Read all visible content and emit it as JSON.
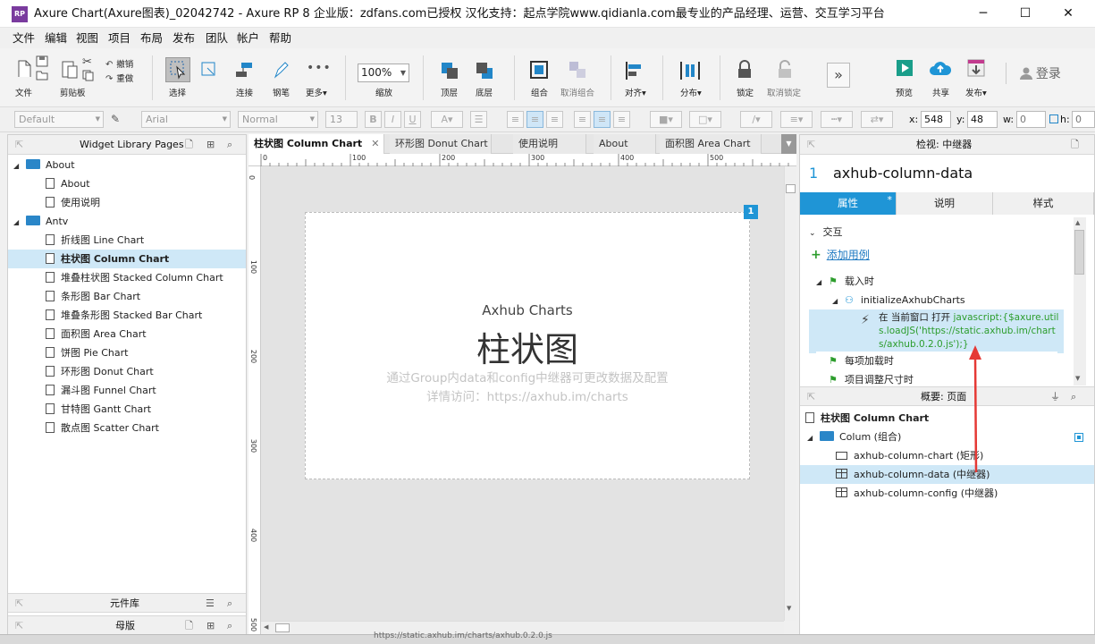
{
  "window": {
    "title": "Axure Chart(Axure图表)_02042742 - Axure RP 8 企业版：zdfans.com已授权 汉化支持：起点学院www.qidianla.com最专业的产品经理、运营、交互学习平台",
    "logo_text": "RP",
    "minimize": "─",
    "maximize": "☐",
    "close": "✕"
  },
  "menu": [
    "文件",
    "编辑",
    "视图",
    "项目",
    "布局",
    "发布",
    "团队",
    "帐户",
    "帮助"
  ],
  "toolbar": {
    "file": "文件",
    "clipboard": "剪贴板",
    "undo": "撤销",
    "redo": "重做",
    "select": "选择",
    "connect": "连接",
    "pen": "钢笔",
    "more": "更多▾",
    "zoom_value": "100%",
    "zoom_label": "缩放",
    "top": "顶层",
    "bottom": "底层",
    "group": "组合",
    "ungroup": "取消组合",
    "align": "对齐▾",
    "distribute": "分布▾",
    "lock": "锁定",
    "unlock": "取消锁定",
    "preview": "预览",
    "share": "共享",
    "publish": "发布▾",
    "login": "登录"
  },
  "formatbar": {
    "style": "Default",
    "font": "Arial",
    "weight": "Normal",
    "size": "13",
    "bold": "B",
    "italic": "I",
    "underline": "U",
    "x_label": "x:",
    "x_value": "548",
    "y_label": "y:",
    "y_value": "48",
    "w_label": "w:",
    "w_value": "0",
    "h_label": "h:",
    "h_value": "0"
  },
  "left_panel": {
    "header": "Widget Library Pages",
    "tree": [
      {
        "label": "About",
        "type": "folder",
        "level": 0
      },
      {
        "label": "About",
        "type": "page",
        "level": 1
      },
      {
        "label": "使用说明",
        "type": "page",
        "level": 1
      },
      {
        "label": "Antv",
        "type": "folder",
        "level": 0
      },
      {
        "label": "折线图 Line Chart",
        "type": "page",
        "level": 1
      },
      {
        "label": "柱状图 Column Chart",
        "type": "page",
        "level": 1,
        "selected": true
      },
      {
        "label": "堆叠柱状图 Stacked Column Chart",
        "type": "page",
        "level": 1
      },
      {
        "label": "条形图 Bar Chart",
        "type": "page",
        "level": 1
      },
      {
        "label": "堆叠条形图 Stacked Bar Chart",
        "type": "page",
        "level": 1
      },
      {
        "label": "面积图 Area Chart",
        "type": "page",
        "level": 1
      },
      {
        "label": "饼图 Pie Chart",
        "type": "page",
        "level": 1
      },
      {
        "label": "环形图 Donut Chart",
        "type": "page",
        "level": 1
      },
      {
        "label": "漏斗图 Funnel Chart",
        "type": "page",
        "level": 1
      },
      {
        "label": "甘特图 Gantt Chart",
        "type": "page",
        "level": 1
      },
      {
        "label": "散点图 Scatter Chart",
        "type": "page",
        "level": 1
      }
    ],
    "widgets_header": "元件库",
    "masters_header": "母版"
  },
  "tabs": [
    {
      "label": "柱状图 Column Chart",
      "active": true
    },
    {
      "label": "环形图 Donut Chart"
    },
    {
      "label": "使用说明"
    },
    {
      "label": "About"
    },
    {
      "label": "面积图 Area Chart"
    }
  ],
  "rulers": {
    "h": [
      "0",
      "100",
      "200",
      "300",
      "400",
      "500"
    ],
    "v": [
      "0",
      "100",
      "200",
      "300",
      "400",
      "500"
    ]
  },
  "canvas": {
    "badge": "1",
    "widget_title": "Axhub Charts",
    "widget_heading": "柱状图",
    "widget_desc": "通过Group内data和config中继器可更改数据及配置",
    "widget_link": "详情访问：https://axhub.im/charts"
  },
  "right_panel": {
    "header": "检视: 中继器",
    "item_number": "1",
    "item_name": "axhub-column-data",
    "tabs": [
      "属性",
      "说明",
      "样式"
    ],
    "tab_star": "*",
    "interactions_label": "交互",
    "add_case": "添加用例",
    "events": [
      {
        "label": "载入时"
      },
      {
        "label": "initializeAxhubCharts"
      }
    ],
    "action_prefix": "在 当前窗口 打开 ",
    "action_code": "javascript:{$axure.utils.loadJS('https://static.axhub.im/charts/axhub.0.2.0.js');}",
    "event_item_loaded": "每项加载时",
    "event_resize": "项目调整尺寸时",
    "outline_header": "概要: 页面",
    "outline_page": "柱状图 Column Chart",
    "outline_group": "Colum (组合)",
    "outline_items": [
      {
        "label": "axhub-column-chart (矩形)",
        "icon": "rect"
      },
      {
        "label": "axhub-column-data (中继器)",
        "icon": "repeater",
        "selected": true
      },
      {
        "label": "axhub-column-config (中继器)",
        "icon": "repeater"
      }
    ]
  },
  "taskbar": {
    "url": "https://static.axhub.im/charts/axhub.0.2.0.js"
  },
  "colors": {
    "accent": "#1f95d6",
    "selection": "#cfe8f7",
    "arrow": "#e53935",
    "code_green": "#2d9d2d"
  }
}
